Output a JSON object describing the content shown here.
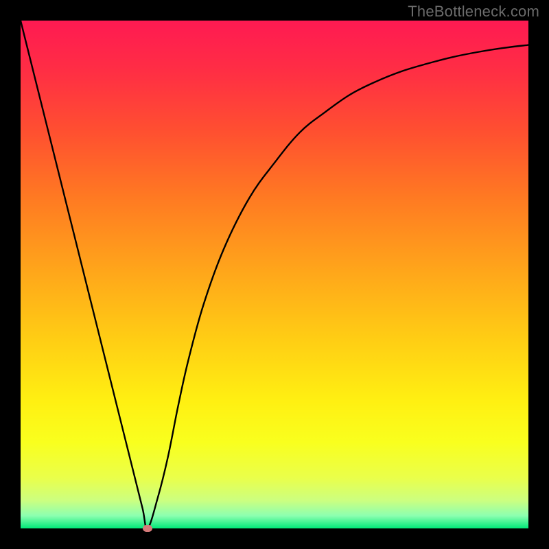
{
  "watermark": "TheBottleneck.com",
  "colors": {
    "frame": "#000000",
    "curve_stroke": "#000000",
    "marker_fill": "#d67a7a",
    "gradient_stops": [
      {
        "offset": 0.0,
        "color": "#ff1a52"
      },
      {
        "offset": 0.1,
        "color": "#ff2e44"
      },
      {
        "offset": 0.22,
        "color": "#ff5030"
      },
      {
        "offset": 0.35,
        "color": "#ff7a22"
      },
      {
        "offset": 0.5,
        "color": "#ffa81a"
      },
      {
        "offset": 0.63,
        "color": "#ffce14"
      },
      {
        "offset": 0.75,
        "color": "#fff012"
      },
      {
        "offset": 0.83,
        "color": "#f9ff1e"
      },
      {
        "offset": 0.9,
        "color": "#eaff4a"
      },
      {
        "offset": 0.945,
        "color": "#ccff80"
      },
      {
        "offset": 0.975,
        "color": "#8cffb0"
      },
      {
        "offset": 1.0,
        "color": "#00e878"
      }
    ]
  },
  "chart_data": {
    "type": "line",
    "title": "",
    "xlabel": "",
    "ylabel": "",
    "xlim": [
      0,
      100
    ],
    "ylim": [
      0,
      100
    ],
    "grid": false,
    "series": [
      {
        "name": "bottleneck-curve",
        "x": [
          0,
          2,
          4,
          6,
          8,
          10,
          12,
          14,
          16,
          18,
          20,
          22,
          24,
          25,
          27,
          29,
          31,
          33,
          36,
          40,
          45,
          50,
          55,
          60,
          65,
          70,
          75,
          80,
          85,
          90,
          95,
          100
        ],
        "y": [
          100,
          92,
          84,
          76,
          68,
          60,
          52,
          44,
          36,
          28,
          20,
          12,
          4,
          0,
          6,
          14,
          24,
          33,
          44,
          55,
          65,
          72,
          78,
          82,
          85.5,
          88,
          90,
          91.5,
          92.8,
          93.8,
          94.6,
          95.2
        ]
      }
    ],
    "marker": {
      "x": 25,
      "y": 0
    },
    "notes": "y=0 is bottom (green), y=100 is top (red). Curve is a V/funnel with minimum at x≈25 and asymptote toward ~95 on the right."
  }
}
